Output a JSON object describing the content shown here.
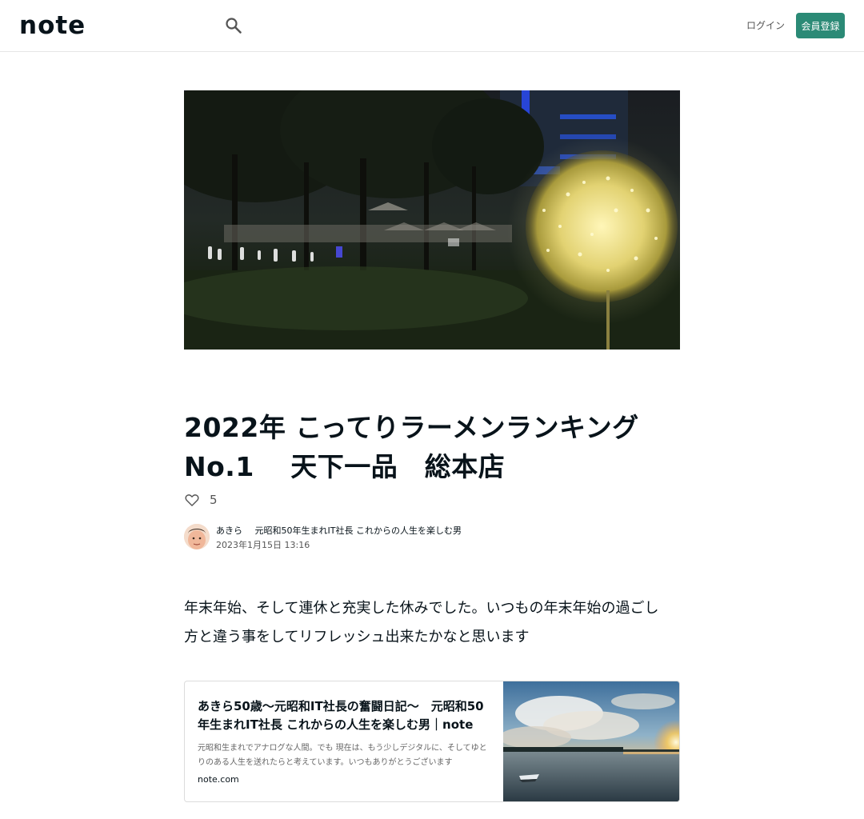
{
  "header": {
    "logo_text": "note",
    "login_label": "ログイン",
    "signup_label": "会員登録"
  },
  "article": {
    "title": "2022年 こってりラーメンランキング No.1 　天下一品　総本店",
    "like_count": "5",
    "author": {
      "name": "あきら",
      "bio": "元昭和50年生まれIT社長 これからの人生を楽しむ男",
      "published": "2023年1月15日 13:16"
    },
    "body": [
      "年末年始、そして連休と充実した休みでした。いつもの年末年始の過ごし",
      "方と違う事をしてリフレッシュ出来たかなと思います"
    ],
    "embed": {
      "title": "あきら50歳〜元昭和IT社長の奮闘日記〜　元昭和50年生まれIT社長 これからの人生を楽しむ男｜note",
      "description": "元昭和生まれでアナログな人間。でも 現在は、もう少しデジタルに、そしてゆとりのある人生を送れたらと考えています。いつもありがとうございます",
      "domain": "note.com"
    }
  },
  "colors": {
    "brand_green": "#2b8a76",
    "text_main": "#08131a"
  },
  "icons": {
    "search": "search-icon",
    "like": "heart-outline-icon"
  }
}
